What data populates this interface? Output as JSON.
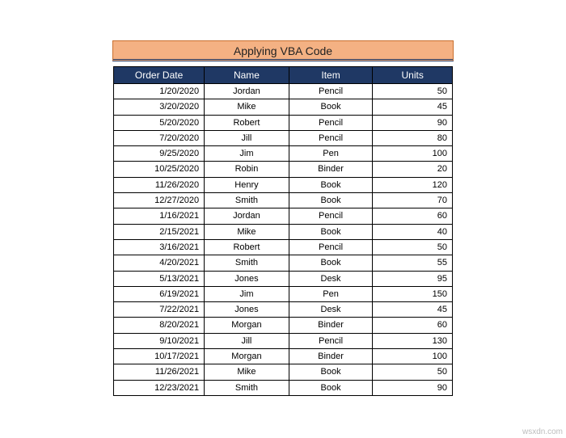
{
  "title": "Applying VBA Code",
  "watermark": "wsxdn.com",
  "columns": [
    "Order Date",
    "Name",
    "Item",
    "Units"
  ],
  "rows": [
    {
      "date": "1/20/2020",
      "name": "Jordan",
      "item": "Pencil",
      "units": 50
    },
    {
      "date": "3/20/2020",
      "name": "Mike",
      "item": "Book",
      "units": 45
    },
    {
      "date": "5/20/2020",
      "name": "Robert",
      "item": "Pencil",
      "units": 90
    },
    {
      "date": "7/20/2020",
      "name": "Jill",
      "item": "Pencil",
      "units": 80
    },
    {
      "date": "9/25/2020",
      "name": "Jim",
      "item": "Pen",
      "units": 100
    },
    {
      "date": "10/25/2020",
      "name": "Robin",
      "item": "Binder",
      "units": 20
    },
    {
      "date": "11/26/2020",
      "name": "Henry",
      "item": "Book",
      "units": 120
    },
    {
      "date": "12/27/2020",
      "name": "Smith",
      "item": "Book",
      "units": 70
    },
    {
      "date": "1/16/2021",
      "name": "Jordan",
      "item": "Pencil",
      "units": 60
    },
    {
      "date": "2/15/2021",
      "name": "Mike",
      "item": "Book",
      "units": 40
    },
    {
      "date": "3/16/2021",
      "name": "Robert",
      "item": "Pencil",
      "units": 50
    },
    {
      "date": "4/20/2021",
      "name": "Smith",
      "item": "Book",
      "units": 55
    },
    {
      "date": "5/13/2021",
      "name": "Jones",
      "item": "Desk",
      "units": 95
    },
    {
      "date": "6/19/2021",
      "name": "Jim",
      "item": "Pen",
      "units": 150
    },
    {
      "date": "7/22/2021",
      "name": "Jones",
      "item": "Desk",
      "units": 45
    },
    {
      "date": "8/20/2021",
      "name": "Morgan",
      "item": "Binder",
      "units": 60
    },
    {
      "date": "9/10/2021",
      "name": "Jill",
      "item": "Pencil",
      "units": 130
    },
    {
      "date": "10/17/2021",
      "name": "Morgan",
      "item": "Binder",
      "units": 100
    },
    {
      "date": "11/26/2021",
      "name": "Mike",
      "item": "Book",
      "units": 50
    },
    {
      "date": "12/23/2021",
      "name": "Smith",
      "item": "Book",
      "units": 90
    }
  ]
}
